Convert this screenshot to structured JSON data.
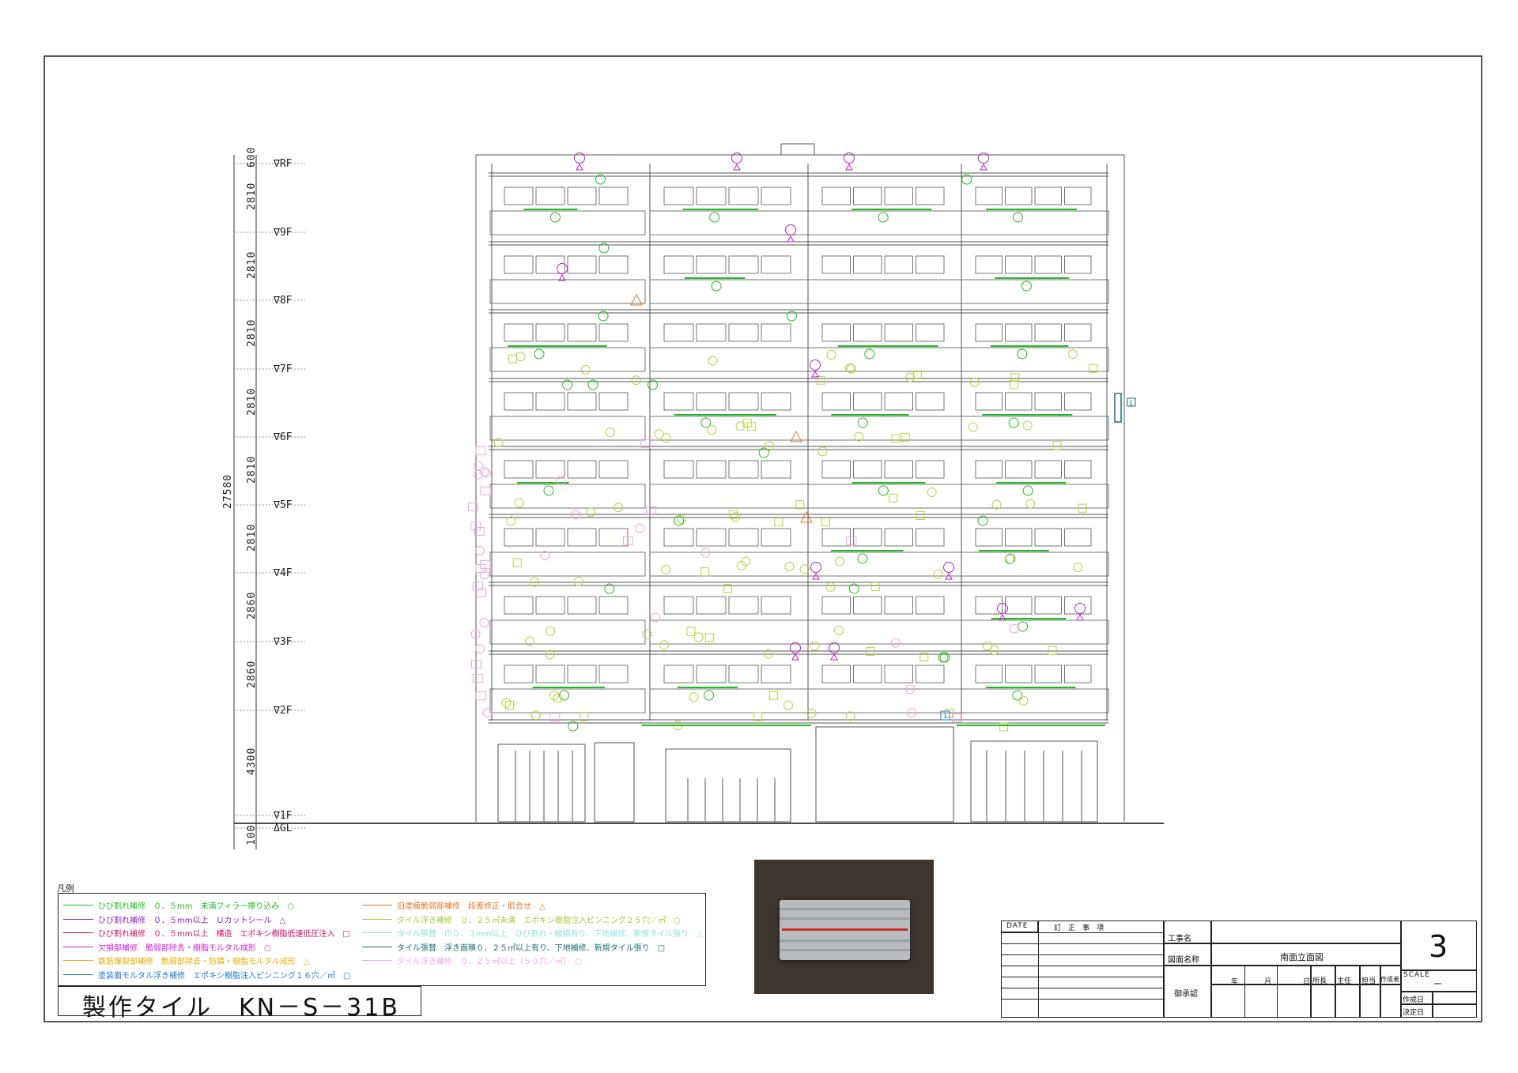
{
  "drawing": {
    "levels": [
      {
        "label": "∇RF"
      },
      {
        "label": "∇9F"
      },
      {
        "label": "∇8F"
      },
      {
        "label": "∇7F"
      },
      {
        "label": "∇6F"
      },
      {
        "label": "∇5F"
      },
      {
        "label": "∇4F"
      },
      {
        "label": "∇3F"
      },
      {
        "label": "∇2F"
      },
      {
        "label": "∇1F"
      },
      {
        "label": "ΔGL"
      }
    ],
    "dimensions": [
      "600",
      "2810",
      "2810",
      "2810",
      "2810",
      "2810",
      "2810",
      "2860",
      "2860",
      "4300",
      "100"
    ],
    "total_height": "27580",
    "box_markers": [
      "1",
      "1"
    ]
  },
  "legend": {
    "title": "凡例",
    "items": [
      {
        "text": "ひび割れ補修　０．５mm　未満フィラー擦り込み　○",
        "color": "#22bb22"
      },
      {
        "text": "ひび割れ補修　０．５mm以上　Ｕカットシール　△",
        "color": "#8a1fbf"
      },
      {
        "text": "ひび割れ補修　０．５mm以上　構造　エポキシ樹脂低速低圧注入　□",
        "color": "#cc1166"
      },
      {
        "text": "欠損部補修　脆弱部除去・樹脂モルタル成形　○",
        "color": "#cc22cc"
      },
      {
        "text": "鉄筋爆裂部補修　脆弱部除去・防錆・樹脂モルタル成形　△",
        "color": "#e0b000"
      },
      {
        "text": "塗装面モルタル浮き補修　エポキシ樹脂注入ピンニング１６穴／㎡　□",
        "color": "#2277cc"
      },
      {
        "text": "旧塗膜脆弱部補修　段差修正・肌合せ　△",
        "color": "#e0782a"
      },
      {
        "text": "タイル浮き補修　０．２５㎡未満　エポキシ樹脂注入ピンニング２５穴／㎡　○",
        "color": "#a8c83a"
      },
      {
        "text": "タイル張替　巾０．３mm以上　ひび割れ・破損有り、下地補修、新規タイル張り　△",
        "color": "#8fe0e0"
      },
      {
        "text": "タイル張替　浮き面積０．２５㎡以上有り、下地補修、新規タイル張り　□",
        "color": "#1a6e6e"
      },
      {
        "text": "タイル浮き補修　０．２５㎡以上（５０穴／㎡）　○",
        "color": "#f0a8e8"
      }
    ]
  },
  "title": {
    "text": "製作タイル　KN－S－31B"
  },
  "title_block": {
    "date_label": "DATE",
    "revision_label": "訂　正　事　項",
    "project_label": "工事名",
    "project_value": "",
    "drawing_name_label": "図面名称",
    "drawing_name_value": "南面立面図",
    "approval_label": "御承認",
    "year_label": "年",
    "month_label": "月",
    "day_label": "日",
    "roles": [
      "所長",
      "主任",
      "担当",
      "作成者"
    ],
    "sheet_number": "3",
    "scale_label": "SCALE",
    "scale_value": "ー",
    "created_label": "作成日",
    "decided_label": "決定日"
  }
}
